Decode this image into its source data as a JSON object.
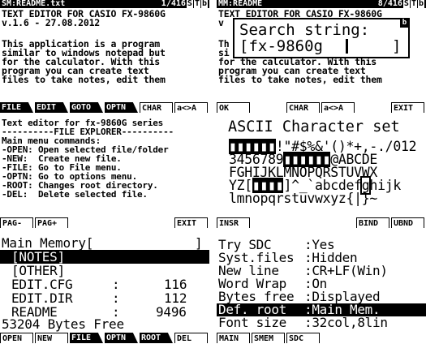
{
  "screen1": {
    "title_left": "SM:README.txt",
    "title_right": "1/416",
    "title_flags": [
      "S",
      "T",
      "b"
    ],
    "lines": [
      "TEXT EDITOR FOR CASIO FX-9860G",
      "v.1.6 - 27.08.2012",
      "",
      "This application is a program",
      "similar to windows notepad but",
      "for the calculator. With this",
      "program you can create text",
      "files to take notes, edit them"
    ],
    "fkeys": [
      "FILE",
      "EDIT",
      "GOTO",
      "OPTN",
      "CHAR",
      "a<>A"
    ]
  },
  "screen2": {
    "title_left": "MM:README",
    "title_right": "8/416",
    "title_flags": [
      "S",
      "T",
      "b"
    ],
    "lines": [
      "TEXT EDITOR FOR CASIO FX-9860G",
      "v",
      "",
      "Th",
      "si",
      "for the calculator. With this",
      "program you can create text",
      "files to take notes, edit them"
    ],
    "dialog": {
      "title": "Search string:",
      "value": "[fx-9860g",
      "close": "]",
      "badge": "b"
    },
    "fkeys": [
      "OK",
      "",
      "CHAR",
      "a<>A",
      "",
      "EXIT"
    ]
  },
  "screen3": {
    "lines": [
      "Text editor for fx-9860G series",
      "----------FILE EXPLORER----------",
      "Main menu commands:",
      "-OPEN: Open selected file/folder",
      "-NEW:  Create new file.",
      "-FILE: Go to File menu.",
      "-OPTN: Go to options menu.",
      "-ROOT: Changes root directory.",
      "-DEL:  Delete selected file."
    ],
    "fkeys": [
      "PAG-",
      "PAG+",
      "",
      "",
      "",
      "EXIT"
    ]
  },
  "screen4": {
    "title": "ASCII Character set",
    "rows": [
      [
        "▮▮▮▮▮▮",
        "!\"#$%&'()*+,-./012"
      ],
      [
        "3456789",
        "▮▮▮▮▮▮",
        "@ABCDE"
      ],
      [
        "FGHIJKLMNOPQRSTUVWX"
      ],
      [
        "YZ[",
        "▮▮▮▮",
        "]^_`abcdef",
        "g",
        "hijk"
      ],
      [
        "lmnopqrstuvwxyz{|}~"
      ]
    ],
    "fkeys": [
      "INSR",
      "",
      "",
      "",
      "BIND",
      "UBND"
    ]
  },
  "screen5": {
    "header": "Main Memory[",
    "header_close": "]",
    "items": [
      {
        "name": "[NOTES]",
        "size": ""
      },
      {
        "name": "[OTHER]",
        "size": ""
      },
      {
        "name": "EDIT.CFG",
        "size": "116"
      },
      {
        "name": "EDIT.DIR",
        "size": "112"
      },
      {
        "name": "README",
        "size": "9496"
      }
    ],
    "free": "53204 Bytes Free",
    "fkeys": [
      "OPEN",
      "NEW",
      "FILE",
      "OPTN",
      "ROOT",
      "DEL"
    ]
  },
  "screen6": {
    "settings": [
      {
        "label": "Try SDC",
        "value": "Yes"
      },
      {
        "label": "Syst.files",
        "value": "Hidden"
      },
      {
        "label": "New line",
        "value": "CR+LF(Win)"
      },
      {
        "label": "Word Wrap",
        "value": "On"
      },
      {
        "label": "Bytes free",
        "value": "Displayed"
      },
      {
        "label": "Def. root",
        "value": "Main Mem."
      },
      {
        "label": "Font size",
        "value": "32col,8lin"
      }
    ],
    "fkeys": [
      "MAIN",
      "SMEM",
      "SDC",
      "",
      "",
      ""
    ]
  }
}
